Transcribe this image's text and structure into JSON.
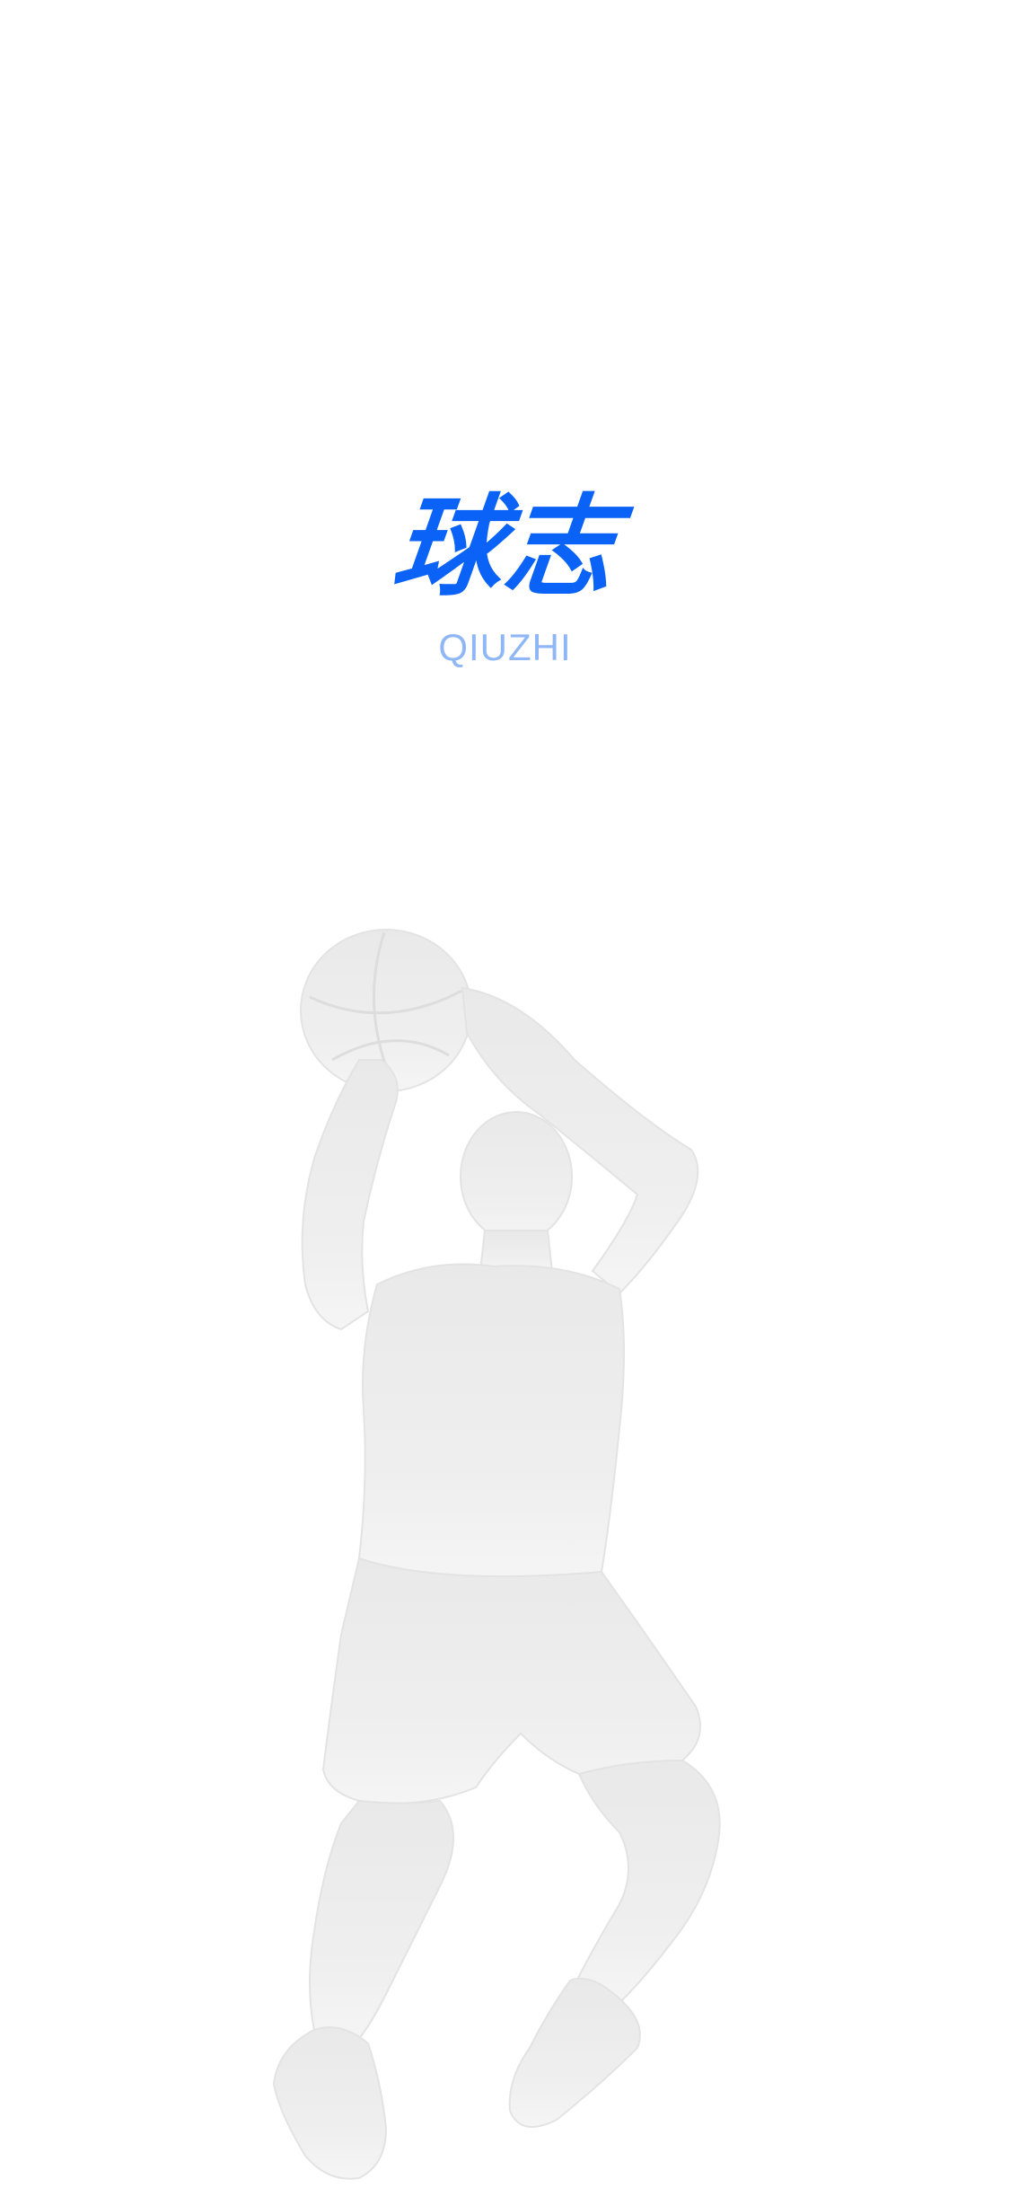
{
  "app": {
    "title": "球志",
    "subtitle": "QIUZHI"
  },
  "colors": {
    "brand": "#0A63F6",
    "brand_light": "#8FB6F6",
    "background": "#FFFFFF",
    "illustration": "#EBEBEB"
  },
  "illustration": {
    "icon": "basketball-player-silhouette"
  }
}
